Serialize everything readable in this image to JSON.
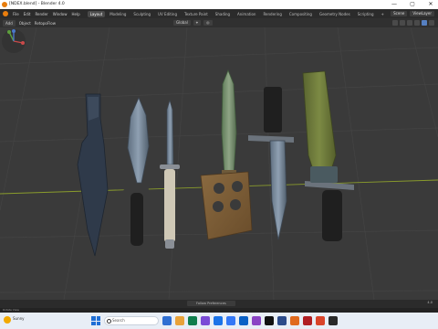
{
  "window": {
    "title": "[NDEX.blend] - Blender 4.0",
    "controls": [
      "—",
      "▢",
      "✕"
    ]
  },
  "topbar": {
    "menu": [
      "File",
      "Edit",
      "Render",
      "Window",
      "Help"
    ],
    "workspaces": [
      {
        "label": "Layout",
        "active": true
      },
      {
        "label": "Modeling"
      },
      {
        "label": "Sculpting"
      },
      {
        "label": "UV Editing"
      },
      {
        "label": "Texture Paint"
      },
      {
        "label": "Shading"
      },
      {
        "label": "Animation"
      },
      {
        "label": "Rendering"
      },
      {
        "label": "Compositing"
      },
      {
        "label": "Geometry Nodes"
      },
      {
        "label": "Scripting"
      },
      {
        "label": "+"
      }
    ],
    "scene_label": "Scene",
    "view_layer_label": "ViewLayer"
  },
  "viewport_header": {
    "edit_label": "Add",
    "object_label": "Object",
    "retopo_label": "RetopoFlow",
    "transform_orientation": "Global"
  },
  "viewport": {
    "axis_x_color": "#8a9c2c",
    "grid_color": "#444444",
    "background": "#3a3a3a"
  },
  "bottom": {
    "follow_label": "Follow Preferences",
    "version": "4.0"
  },
  "status": {
    "left_text": "Rotate View"
  },
  "taskbar": {
    "weather_text": "Sunny",
    "search_placeholder": "Search",
    "clock_time": "",
    "clock_date": "",
    "app_colors": [
      "#2f6fd2",
      "#e8a23a",
      "#0f7d4d",
      "#7a4bd6",
      "#1a73e8",
      "#3478f6",
      "#0a60c5",
      "#8a44c4",
      "#111111",
      "#2c4b8a",
      "#e06a1e",
      "#b01f24",
      "#d9442a",
      "#2a2a2a"
    ]
  }
}
